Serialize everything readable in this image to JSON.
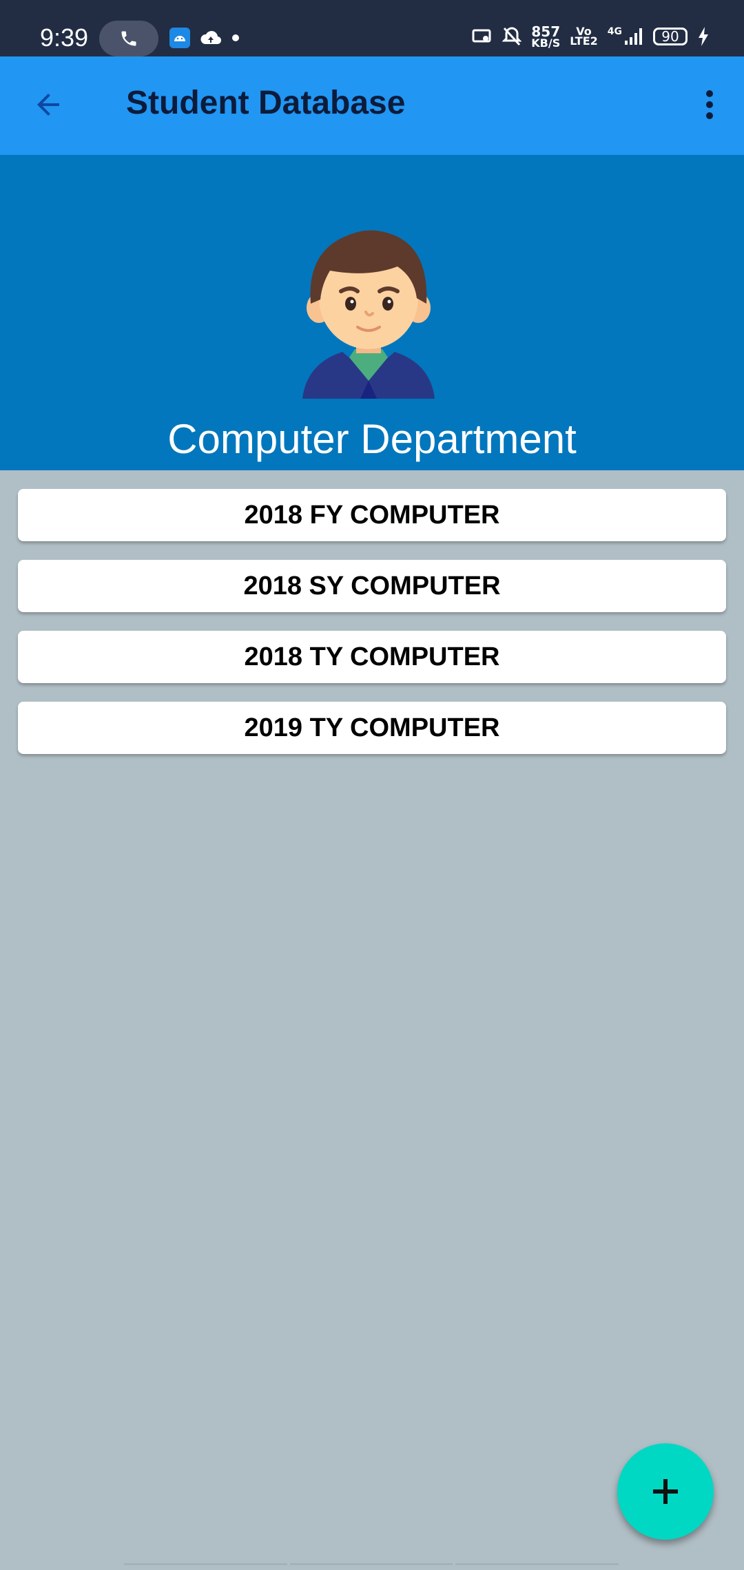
{
  "status_bar": {
    "time": "9:39",
    "speed_value": "857",
    "speed_unit": "KB/S",
    "volte_top": "Vo",
    "volte_bottom": "LTE2",
    "network": "4G",
    "battery": "90",
    "icons": [
      "phone-icon",
      "app-icon",
      "cloud-upload-icon",
      "dot-icon",
      "cast-icon",
      "bell-off-icon",
      "signal-icon",
      "charging-icon"
    ]
  },
  "app_bar": {
    "title": "Student Database",
    "back_icon": "arrow-back-icon",
    "menu_icon": "more-vert-icon",
    "color": "#2196f3"
  },
  "header": {
    "department": "Computer Department",
    "color": "#0277bd"
  },
  "classes": [
    {
      "label": "2018 FY COMPUTER"
    },
    {
      "label": "2018 SY COMPUTER"
    },
    {
      "label": "2018 TY COMPUTER"
    },
    {
      "label": "2019 TY COMPUTER"
    }
  ],
  "fab": {
    "icon": "plus-icon",
    "color": "#00d8c3"
  },
  "background_color": "#b0bec5"
}
